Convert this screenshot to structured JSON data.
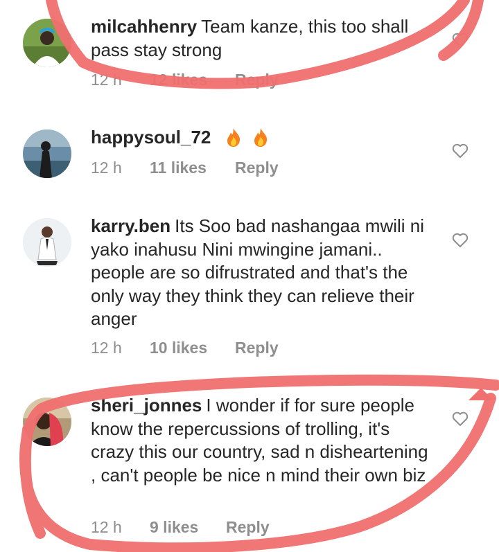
{
  "comments": [
    {
      "username": "milcahhenry",
      "text": "Team kanze, this too shall pass stay strong",
      "time": "12 h",
      "likes": "12 likes",
      "reply": "Reply"
    },
    {
      "username": "happysoul_72",
      "text": "",
      "emoji": [
        "fire-emoji",
        "fire-emoji"
      ],
      "time": "12 h",
      "likes": "11 likes",
      "reply": "Reply"
    },
    {
      "username": "karry.ben",
      "text": "Its Soo bad nashangaa mwili ni yako inahusu Nini mwingine jamani.. people are so difrustrated and that's the only way they think they can relieve their anger",
      "time": "12 h",
      "likes": "10 likes",
      "reply": "Reply"
    },
    {
      "username": "sheri_jonnes",
      "text": "I wonder if for sure people know the repercussions of trolling,  it's crazy this our country,  sad n disheartening , can't people be nice n mind their own biz",
      "time": "12 h",
      "likes": "9 likes",
      "reply": "Reply"
    }
  ],
  "icons": {
    "like": "heart-outline-icon"
  },
  "colors": {
    "annotation": "#f06f6f",
    "meta": "#8e8e8e",
    "text": "#262626"
  }
}
